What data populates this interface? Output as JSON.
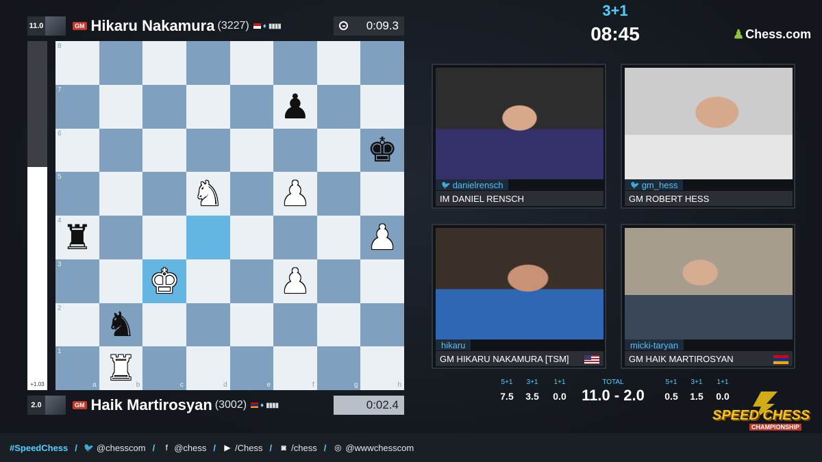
{
  "top_player": {
    "score": "11.0",
    "title": "GM",
    "name": "Hikaru Nakamura",
    "rating": "(3227)",
    "clock": "0:09.3"
  },
  "bottom_player": {
    "score": "2.0",
    "title": "GM",
    "name": "Haik Martirosyan",
    "rating": "(3002)",
    "clock": "0:02.4"
  },
  "eval": {
    "label": "+1.03",
    "white_fraction": 0.64
  },
  "match": {
    "time_control": "3+1",
    "timer": "08:45",
    "brand": "Chess.com"
  },
  "board": {
    "ranks": [
      "8",
      "7",
      "6",
      "5",
      "4",
      "3",
      "2",
      "1"
    ],
    "files": [
      "a",
      "b",
      "c",
      "d",
      "e",
      "f",
      "g",
      "h"
    ],
    "highlight": [
      "d4",
      "c3"
    ],
    "pieces": [
      {
        "sq": "f7",
        "glyph": "♟",
        "color": "b",
        "name": "black-pawn"
      },
      {
        "sq": "h6",
        "glyph": "♚",
        "color": "b",
        "name": "black-king"
      },
      {
        "sq": "d5",
        "glyph": "♞",
        "color": "w",
        "name": "white-knight"
      },
      {
        "sq": "f5",
        "glyph": "♟",
        "color": "w",
        "name": "white-pawn"
      },
      {
        "sq": "a4",
        "glyph": "♜",
        "color": "b",
        "name": "black-rook"
      },
      {
        "sq": "h4",
        "glyph": "♟",
        "color": "w",
        "name": "white-pawn"
      },
      {
        "sq": "c3",
        "glyph": "♚",
        "color": "w",
        "name": "white-king"
      },
      {
        "sq": "f3",
        "glyph": "♟",
        "color": "w",
        "name": "white-pawn"
      },
      {
        "sq": "b2",
        "glyph": "♞",
        "color": "b",
        "name": "black-knight"
      },
      {
        "sq": "b1",
        "glyph": "♜",
        "color": "w",
        "name": "white-rook"
      }
    ]
  },
  "cams": [
    {
      "handle": "danielrensch",
      "twitter": true,
      "caption": "IM DANIEL RENSCH"
    },
    {
      "handle": "gm_hess",
      "twitter": true,
      "caption": "GM ROBERT HESS"
    },
    {
      "handle": "hikaru",
      "twitter": false,
      "caption": "GM HIKARU NAKAMURA [TSM]",
      "flag": "us"
    },
    {
      "handle": "micki-taryan",
      "twitter": false,
      "caption": "GM HAIK MARTIROSYAN",
      "flag": "am"
    }
  ],
  "scores": {
    "left_heads": [
      "5+1",
      "3+1",
      "1+1"
    ],
    "left_vals": [
      "7.5",
      "3.5",
      "0.0"
    ],
    "total_head": "TOTAL",
    "total": "11.0 - 2.0",
    "right_heads": [
      "5+1",
      "3+1",
      "1+1"
    ],
    "right_vals": [
      "0.5",
      "1.5",
      "0.0"
    ]
  },
  "event_logo": {
    "line1": "SPEED CHESS",
    "line2": "CHAMPIONSHIP"
  },
  "footer": {
    "hashtag": "#SpeedChess",
    "socials": [
      {
        "icon": "twitter-icon",
        "glyph": "🐦",
        "text": "@chesscom"
      },
      {
        "icon": "facebook-icon",
        "glyph": "f",
        "text": "@chess"
      },
      {
        "icon": "youtube-icon",
        "glyph": "▶",
        "text": "/Chess"
      },
      {
        "icon": "twitch-icon",
        "glyph": "◙",
        "text": "/chess"
      },
      {
        "icon": "instagram-icon",
        "glyph": "◎",
        "text": "@wwwchesscom"
      }
    ]
  },
  "colors": {
    "accent": "#4fd0ff",
    "board_light": "#eaf0f4",
    "board_dark": "#7fa1bf",
    "highlight": "#63b6e2",
    "gm_badge": "#c0392b"
  }
}
